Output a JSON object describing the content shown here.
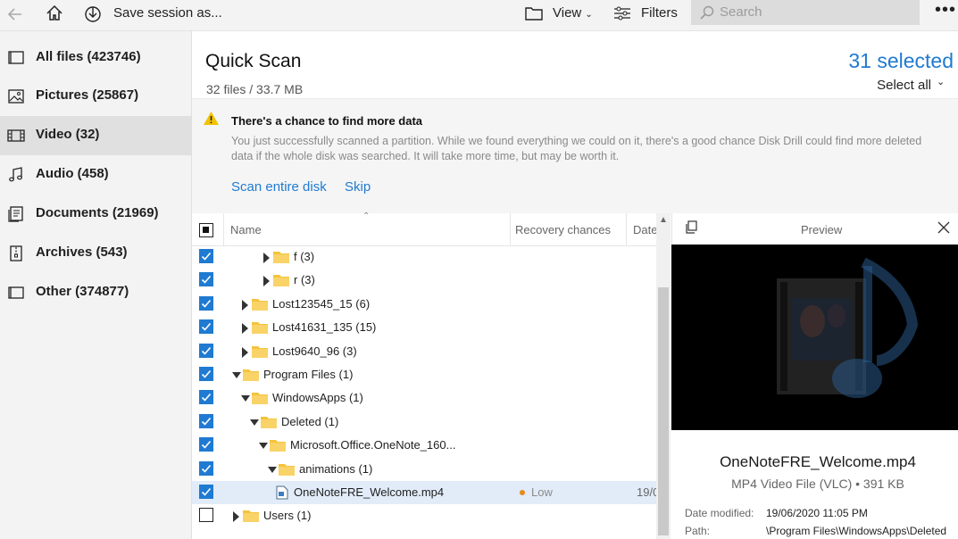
{
  "toolbar": {
    "save_session": "Save session as...",
    "view": "View",
    "filters": "Filters",
    "search_placeholder": "Search"
  },
  "sidebar": {
    "items": [
      {
        "label": "All files (423746)",
        "icon": "all-files-icon"
      },
      {
        "label": "Pictures (25867)",
        "icon": "picture-icon"
      },
      {
        "label": "Video (32)",
        "icon": "film-icon",
        "active": true
      },
      {
        "label": "Audio (458)",
        "icon": "music-note-icon"
      },
      {
        "label": "Documents (21969)",
        "icon": "document-icon"
      },
      {
        "label": "Archives (543)",
        "icon": "archive-icon"
      },
      {
        "label": "Other (374877)",
        "icon": "other-icon"
      }
    ]
  },
  "header": {
    "title": "Quick Scan",
    "subtitle": "32 files / 33.7 MB",
    "selected": "31 selected",
    "select_all": "Select all"
  },
  "banner": {
    "heading": "There's a chance to find more data",
    "body": "You just successfully scanned a partition. While we found everything we could on it, there's a good chance Disk Drill could find more deleted data if the whole disk was searched. It will take more time, but may be worth it.",
    "scan_link": "Scan entire disk",
    "skip_link": "Skip"
  },
  "table": {
    "columns": {
      "name": "Name",
      "recovery": "Recovery chances",
      "date": "Date"
    },
    "rows": [
      {
        "name": "f (3)",
        "checked": true,
        "type": "folder",
        "expanded": false
      },
      {
        "name": "r (3)",
        "checked": true,
        "type": "folder",
        "expanded": false
      },
      {
        "name": "Lost123545_15 (6)",
        "checked": true,
        "type": "folder",
        "expanded": false
      },
      {
        "name": "Lost41631_135 (15)",
        "checked": true,
        "type": "folder",
        "expanded": false
      },
      {
        "name": "Lost9640_96 (3)",
        "checked": true,
        "type": "folder",
        "expanded": false
      },
      {
        "name": "Program Files (1)",
        "checked": true,
        "type": "folder",
        "expanded": true
      },
      {
        "name": "WindowsApps (1)",
        "checked": true,
        "type": "folder",
        "expanded": true
      },
      {
        "name": "Deleted (1)",
        "checked": true,
        "type": "folder",
        "expanded": true
      },
      {
        "name": "Microsoft.Office.OneNote_160...",
        "checked": true,
        "type": "folder",
        "expanded": true
      },
      {
        "name": "animations (1)",
        "checked": true,
        "type": "folder",
        "expanded": true
      },
      {
        "name": "OneNoteFRE_Welcome.mp4",
        "checked": true,
        "type": "file",
        "recovery": "Low",
        "date": "19/0",
        "selected": true
      },
      {
        "name": "Users (1)",
        "checked": false,
        "type": "folder",
        "expanded": false
      }
    ]
  },
  "preview": {
    "title": "Preview",
    "file_name": "OneNoteFRE_Welcome.mp4",
    "file_type": "MP4 Video File (VLC) • 391 KB",
    "date_label": "Date modified:",
    "date_value": "19/06/2020 11:05 PM",
    "path_label": "Path:",
    "path_value": "\\Program Files\\WindowsApps\\Deleted"
  },
  "colors": {
    "accent": "#1f7ad1",
    "warning": "#f2c200",
    "folder": "#f5c33b",
    "low": "#e8891a"
  }
}
